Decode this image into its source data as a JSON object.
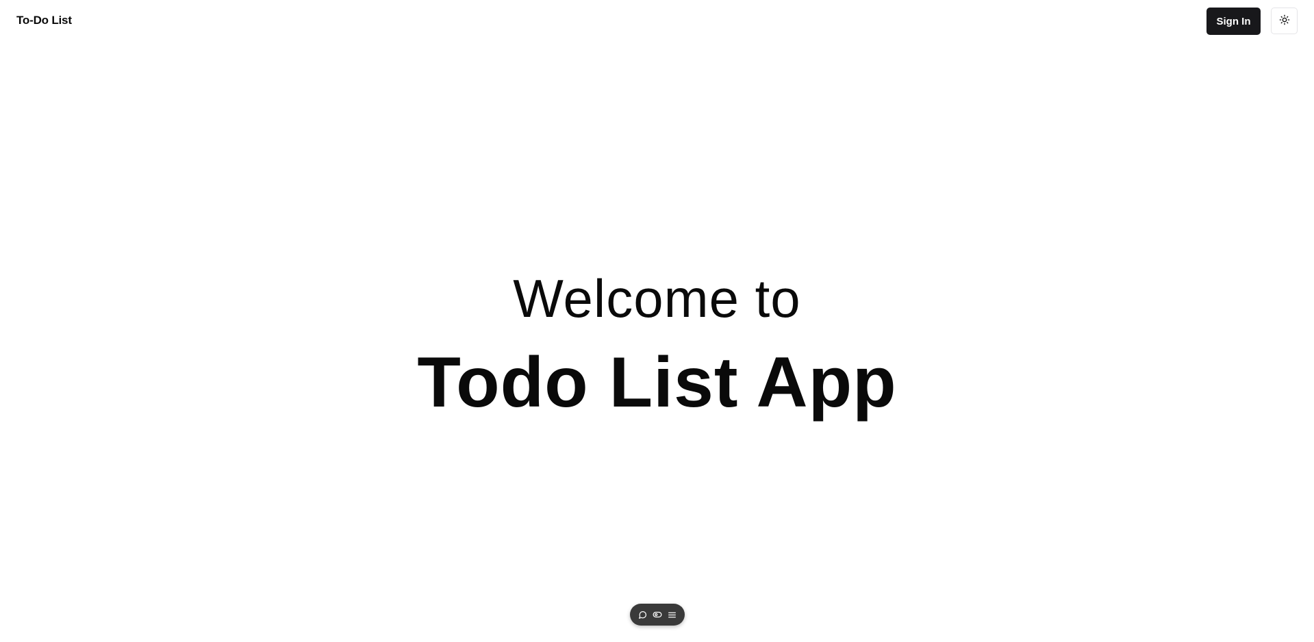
{
  "header": {
    "brand": "To-Do List",
    "sign_in_label": "Sign In",
    "theme_icon": "sun-icon"
  },
  "hero": {
    "subtitle": "Welcome to",
    "title": "Todo List App"
  },
  "dock": {
    "icons": [
      "chat-icon",
      "toggle-icon",
      "menu-icon"
    ]
  },
  "colors": {
    "background": "#ffffff",
    "text": "#0a0a0a",
    "button_bg": "#18181b",
    "button_text": "#ffffff",
    "border": "#e4e4e7",
    "dock_bg": "#3a3a3a"
  }
}
